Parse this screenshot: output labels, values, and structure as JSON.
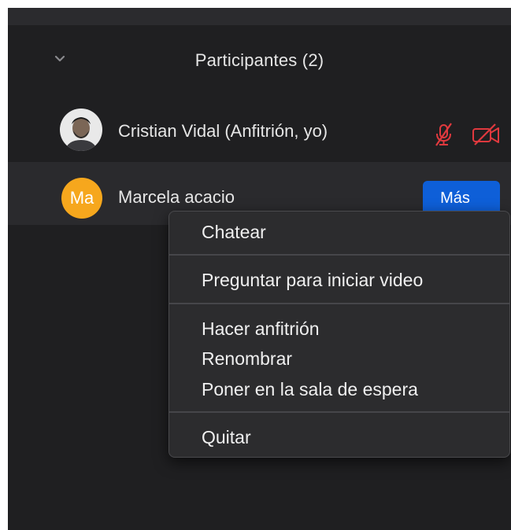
{
  "panel": {
    "title": "Participantes (2)",
    "collapse_icon": "chevron-down-icon"
  },
  "participants": [
    {
      "name": "Cristian Vidal (Anfitrión, yo)",
      "avatar": "photo",
      "status_icons": [
        "muted-microphone-icon",
        "video-off-icon"
      ],
      "status_color": "#e0393e"
    },
    {
      "name": "Marcela acacio",
      "avatar_initials": "Ma",
      "avatar_color": "#f6a71d",
      "more_button": "Más"
    }
  ],
  "context_menu": {
    "groups": [
      [
        "Chatear"
      ],
      [
        "Preguntar para iniciar video"
      ],
      [
        "Hacer anfitrión",
        "Renombrar",
        "Poner en la sala de espera"
      ],
      [
        "Quitar"
      ]
    ]
  },
  "colors": {
    "panel_bg": "#1f1f21",
    "menu_bg": "#2c2c2e",
    "accent_button": "#0e5fd8",
    "text": "#e6e6e6"
  }
}
